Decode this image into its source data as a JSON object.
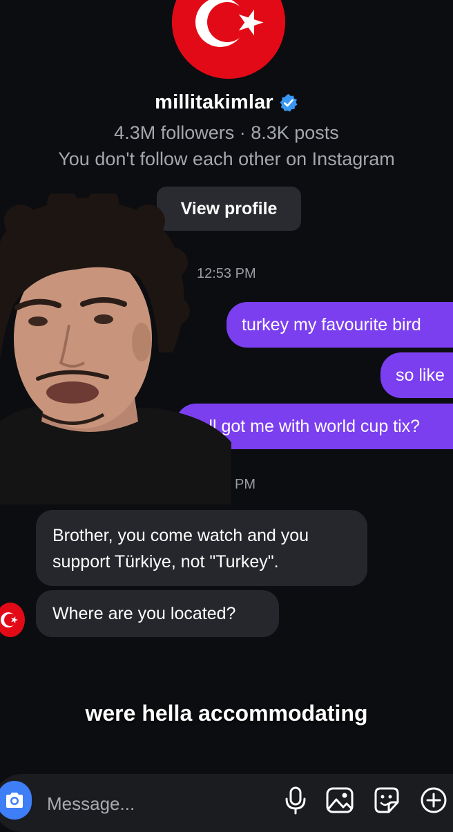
{
  "profile": {
    "username": "millitakimlar",
    "stats": "4.3M followers · 8.3K posts",
    "relation": "You don't follow each other on Instagram",
    "view_profile_label": "View profile"
  },
  "thread": {
    "timestamp_1": "12:53 PM",
    "outgoing": [
      "turkey my favourite bird",
      "so like",
      "yall got me with world cup tix?"
    ],
    "timestamp_2_visible": "PM",
    "incoming": [
      "Brother, you come watch and you",
      "support Türkiye, not \"Turkey\".",
      "Where are you located?"
    ]
  },
  "caption": "were hella accommodating",
  "composer": {
    "placeholder": "Message...",
    "icons": [
      "camera-icon",
      "microphone-icon",
      "gallery-icon",
      "sticker-icon",
      "add-icon"
    ]
  },
  "colors": {
    "background": "#0c0d10",
    "outgoing_bubble": "#7b3ff0",
    "incoming_bubble": "#26272c",
    "verified": "#3897f0",
    "flag_red": "#e30a17",
    "camera_button": "#3e7ef7"
  }
}
